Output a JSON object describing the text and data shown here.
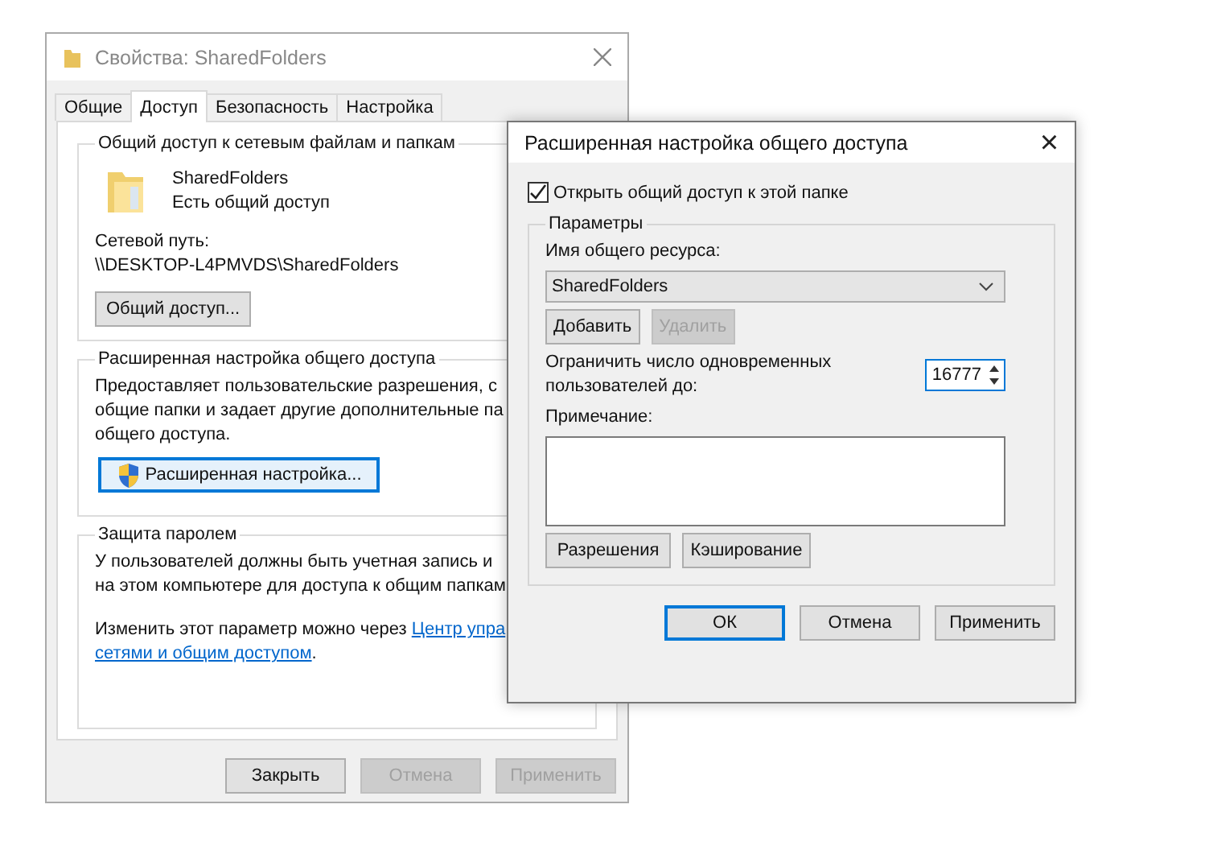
{
  "properties_window": {
    "title": "Свойства: SharedFolders",
    "tabs": [
      {
        "label": "Общие",
        "selected": false
      },
      {
        "label": "Доступ",
        "selected": true
      },
      {
        "label": "Безопасность",
        "selected": false
      },
      {
        "label": "Настройка",
        "selected": false
      }
    ],
    "network_sharing": {
      "heading": "Общий доступ к сетевым файлам и папкам",
      "folder_name": "SharedFolders",
      "status": "Есть общий доступ",
      "path_label": "Сетевой путь:",
      "path": "\\\\DESKTOP-L4PMVDS\\SharedFolders",
      "button": {
        "label": "Общий доступ...",
        "disabled": false,
        "focused": false
      }
    },
    "advanced_sharing": {
      "heading": "Расширенная настройка общего доступа",
      "lines": [
        "Предоставляет пользовательские разрешения, с",
        "общие папки и задает другие дополнительные па",
        "общего доступа."
      ],
      "button": {
        "label": "Расширенная настройка...",
        "disabled": false,
        "focused": true
      }
    },
    "password_protection": {
      "heading": "Защита паролем",
      "lines": [
        "У пользователей должны быть учетная запись и",
        "на этом компьютере для доступа к общим папкам"
      ],
      "change_text": "Изменить этот параметр можно через ",
      "link_1": "Центр упра",
      "link_2": "сетями и общим доступом",
      "link_end": "."
    },
    "buttons": [
      {
        "label": "Закрыть",
        "disabled": false,
        "focused": false
      },
      {
        "label": "Отмена",
        "disabled": true,
        "focused": false
      },
      {
        "label": "Применить",
        "disabled": true,
        "focused": false
      }
    ]
  },
  "advanced_dialog": {
    "title": "Расширенная настройка общего доступа",
    "close": "×",
    "share_checkbox": {
      "label": "Открыть общий доступ к этой папке",
      "checked": true
    },
    "group": {
      "heading": "Параметры",
      "share_name_label": "Имя общего ресурса:",
      "share_name": "SharedFolders",
      "name_buttons": [
        {
          "label": "Добавить",
          "disabled": false,
          "focused": false
        },
        {
          "label": "Удалить",
          "disabled": true,
          "focused": false
        }
      ],
      "limit_label": [
        "Ограничить число одновременных",
        "пользователей до:"
      ],
      "limit_value": "16777",
      "comment_label": "Примечание:",
      "bottom_buttons": [
        {
          "label": "Разрешения",
          "disabled": false,
          "focused": false
        },
        {
          "label": "Кэширование",
          "disabled": false,
          "focused": false
        }
      ]
    },
    "buttons": [
      {
        "label": "ОК",
        "disabled": false,
        "focused": true
      },
      {
        "label": "Отмена",
        "disabled": false,
        "focused": false
      },
      {
        "label": "Применить",
        "disabled": false,
        "focused": false
      }
    ]
  }
}
